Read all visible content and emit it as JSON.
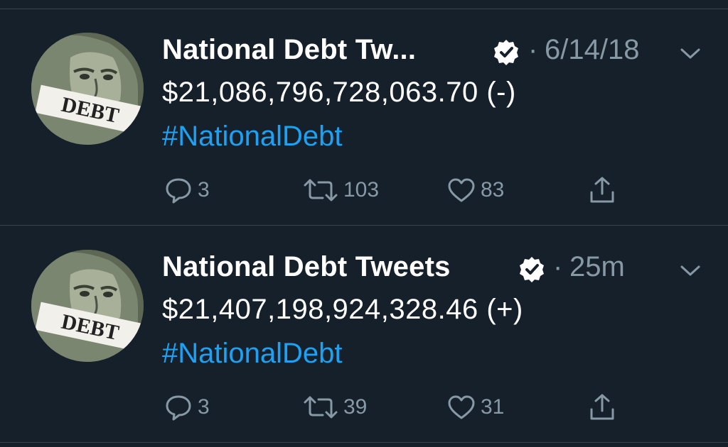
{
  "colors": {
    "background": "#15202b",
    "divider": "#38444d",
    "text": "#ffffff",
    "muted": "#8899a6",
    "link": "#1da1f2"
  },
  "tweets": [
    {
      "author_name": "National Debt Tw...",
      "verified_icon": "verified-badge-icon",
      "separator": "·",
      "timestamp": "6/14/18",
      "amount": "$21,086,796,728,063.70 (-)",
      "hashtag": "#NationalDebt",
      "avatar_text": "DEBT",
      "replies": "3",
      "retweets": "103",
      "likes": "83"
    },
    {
      "author_name": "National Debt Tweets",
      "verified_icon": "verified-badge-icon",
      "separator": "·",
      "timestamp": "25m",
      "amount": "$21,407,198,924,328.46 (+)",
      "hashtag": "#NationalDebt",
      "avatar_text": "DEBT",
      "replies": "3",
      "retweets": "39",
      "likes": "31"
    }
  ]
}
